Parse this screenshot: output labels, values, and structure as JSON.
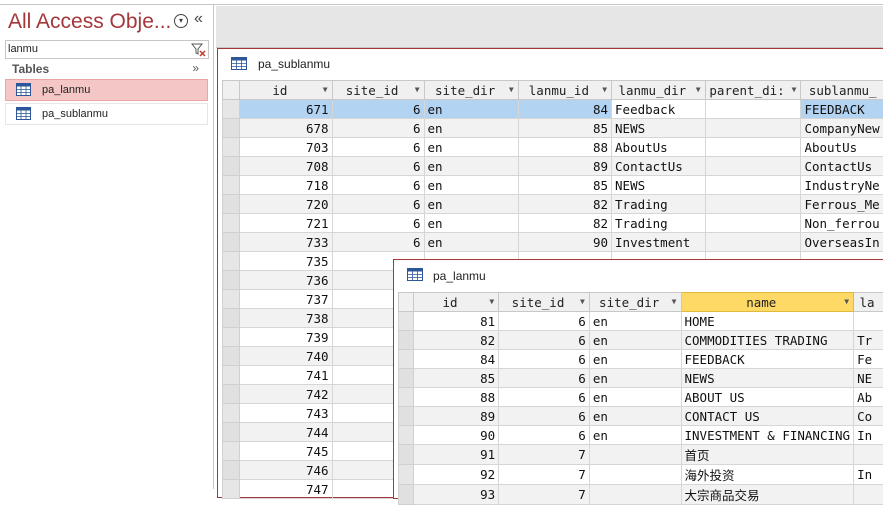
{
  "nav": {
    "title": "All Access Obje...",
    "menu_icon": "circle-down-icon",
    "collapse_icon": "double-chevron-left-icon",
    "search_value": "lanmu",
    "search_clear_icon": "filter-clear-icon",
    "group_label": "Tables",
    "group_collapse_icon": "double-chevron-up-icon",
    "items": [
      {
        "label": "pa_lanmu",
        "selected": true
      },
      {
        "label": "pa_sublanmu",
        "selected": false
      }
    ]
  },
  "colors": {
    "accent": "#a4373a",
    "selected_item_bg": "#f4c6c6",
    "selected_row": "#b3d3f3",
    "sorted_header": "#ffd966"
  },
  "win1": {
    "title": "pa_sublanmu",
    "columns": [
      "id",
      "site_id",
      "site_dir",
      "lanmu_id",
      "lanmu_dir",
      "parent_di:",
      "sublanmu_"
    ],
    "rows": [
      [
        "671",
        "6",
        "en",
        "84",
        "Feedback",
        "",
        "FEEDBACK"
      ],
      [
        "678",
        "6",
        "en",
        "85",
        "NEWS",
        "",
        "CompanyNew"
      ],
      [
        "703",
        "6",
        "en",
        "88",
        "AboutUs",
        "",
        "AboutUs"
      ],
      [
        "708",
        "6",
        "en",
        "89",
        "ContactUs",
        "",
        "ContactUs"
      ],
      [
        "718",
        "6",
        "en",
        "85",
        "NEWS",
        "",
        "IndustryNe"
      ],
      [
        "720",
        "6",
        "en",
        "82",
        "Trading",
        "",
        "Ferrous_Me"
      ],
      [
        "721",
        "6",
        "en",
        "82",
        "Trading",
        "",
        "Non_ferrou"
      ],
      [
        "733",
        "6",
        "en",
        "90",
        "Investment",
        "",
        "OverseasIn"
      ],
      [
        "735",
        "",
        "",
        "",
        "",
        "",
        ""
      ],
      [
        "736",
        "",
        "",
        "",
        "",
        "",
        ""
      ],
      [
        "737",
        "",
        "",
        "",
        "",
        "",
        ""
      ],
      [
        "738",
        "",
        "",
        "",
        "",
        "",
        ""
      ],
      [
        "739",
        "",
        "",
        "",
        "",
        "",
        ""
      ],
      [
        "740",
        "",
        "",
        "",
        "",
        "",
        ""
      ],
      [
        "741",
        "",
        "",
        "",
        "",
        "",
        ""
      ],
      [
        "742",
        "",
        "",
        "",
        "",
        "",
        ""
      ],
      [
        "743",
        "",
        "",
        "",
        "",
        "",
        ""
      ],
      [
        "744",
        "",
        "",
        "",
        "",
        "",
        ""
      ],
      [
        "745",
        "",
        "",
        "",
        "",
        "",
        ""
      ],
      [
        "746",
        "",
        "",
        "",
        "",
        "",
        ""
      ],
      [
        "747",
        "",
        "",
        "",
        "",
        "",
        ""
      ]
    ]
  },
  "win2": {
    "title": "pa_lanmu",
    "columns": [
      "id",
      "site_id",
      "site_dir",
      "name",
      "la"
    ],
    "rows": [
      [
        "81",
        "6",
        "en",
        "HOME",
        ""
      ],
      [
        "82",
        "6",
        "en",
        "COMMODITIES TRADING",
        "Tr"
      ],
      [
        "84",
        "6",
        "en",
        "FEEDBACK",
        "Fe"
      ],
      [
        "85",
        "6",
        "en",
        "NEWS",
        "NE"
      ],
      [
        "88",
        "6",
        "en",
        "ABOUT US",
        "Ab"
      ],
      [
        "89",
        "6",
        "en",
        "CONTACT US",
        "Co"
      ],
      [
        "90",
        "6",
        "en",
        "INVESTMENT & FINANCING",
        "In"
      ],
      [
        "91",
        "7",
        "",
        "首页",
        ""
      ],
      [
        "92",
        "7",
        "",
        "海外投资",
        "In"
      ],
      [
        "93",
        "7",
        "",
        "大宗商品交易",
        ""
      ]
    ]
  }
}
